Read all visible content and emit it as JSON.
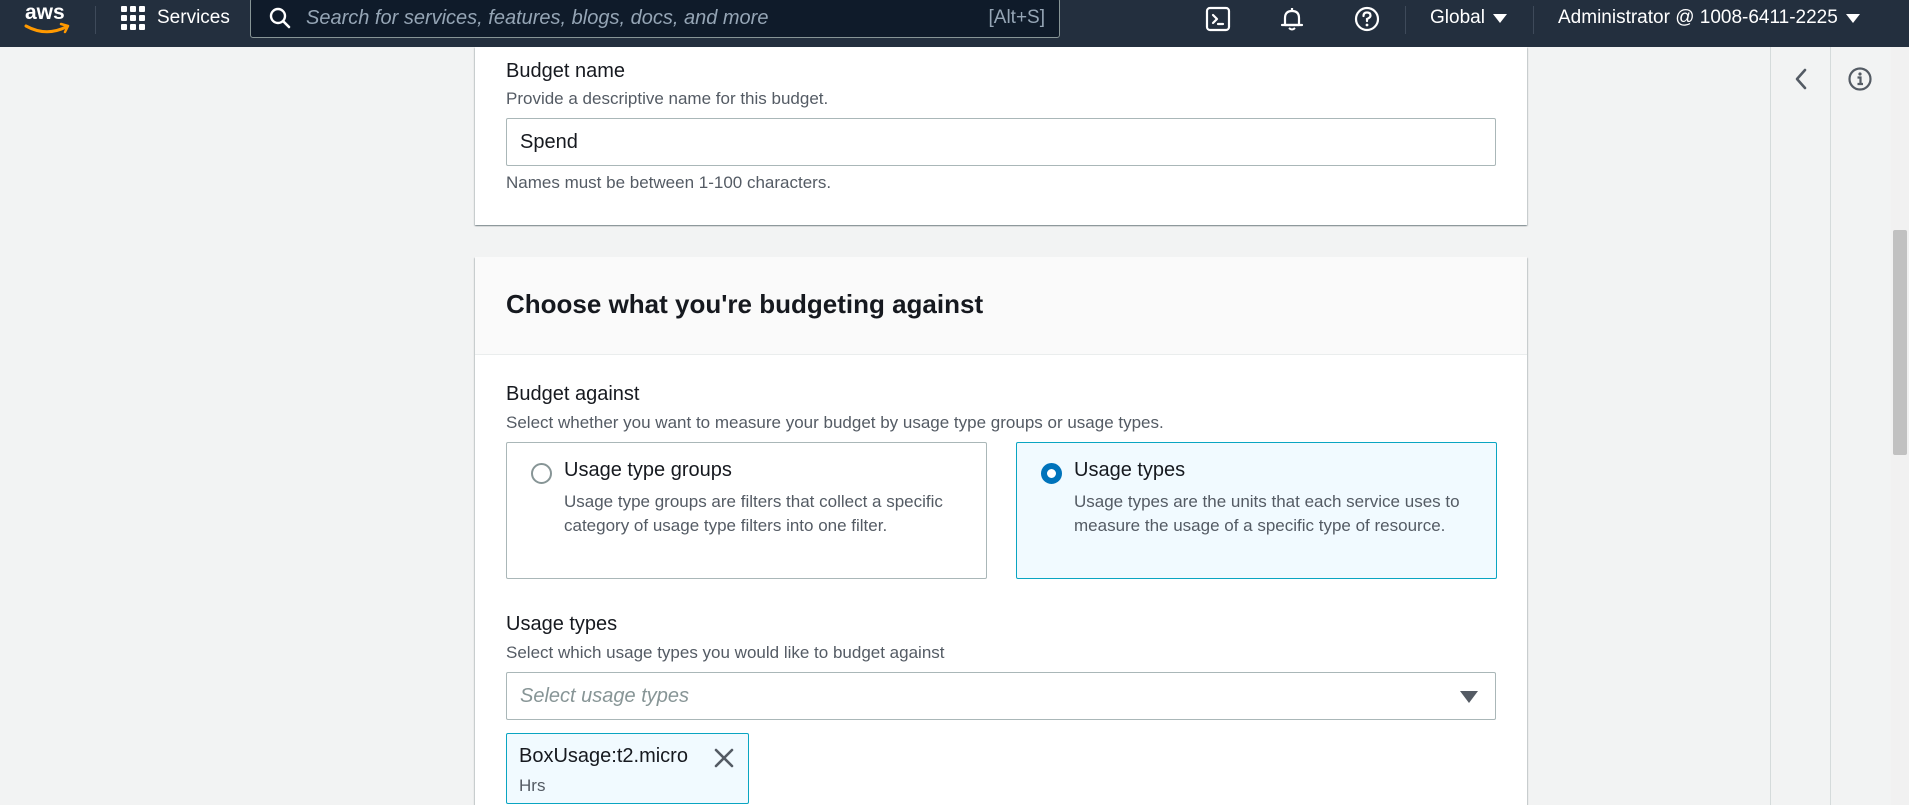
{
  "nav": {
    "services_label": "Services",
    "search_placeholder": "Search for services, features, blogs, docs, and more",
    "search_shortcut": "[Alt+S]",
    "region": "Global",
    "account": "Administrator @ 1008-6411-2225"
  },
  "budget_name": {
    "label": "Budget name",
    "description": "Provide a descriptive name for this budget.",
    "value": "Spend",
    "constraint": "Names must be between 1-100 characters."
  },
  "budgeting_against": {
    "title": "Choose what you're budgeting against",
    "label": "Budget against",
    "description": "Select whether you want to measure your budget by usage type groups or usage types.",
    "options": [
      {
        "title": "Usage type groups",
        "description": "Usage type groups are filters that collect a specific category of usage type filters into one filter.",
        "selected": false
      },
      {
        "title": "Usage types",
        "description": "Usage types are the units that each service uses to measure the usage of a specific type of resource.",
        "selected": true
      }
    ],
    "usage_types": {
      "label": "Usage types",
      "description": "Select which usage types you would like to budget against",
      "placeholder": "Select usage types",
      "selected_tokens": [
        {
          "label": "BoxUsage:t2.micro",
          "sub": "Hrs"
        }
      ]
    }
  },
  "colors": {
    "nav_bg": "#232f3e",
    "accent": "#0073bb",
    "selected_border": "#0aa5c2",
    "selected_bg": "#f1faff"
  },
  "icons": {
    "logo": "aws-logo",
    "apps": "grid-icon",
    "search": "search-icon",
    "cloudshell": "terminal-icon",
    "notifications": "bell-icon",
    "help": "help-icon",
    "collapse": "chevron-left-icon",
    "info": "info-icon",
    "remove": "close-icon"
  }
}
